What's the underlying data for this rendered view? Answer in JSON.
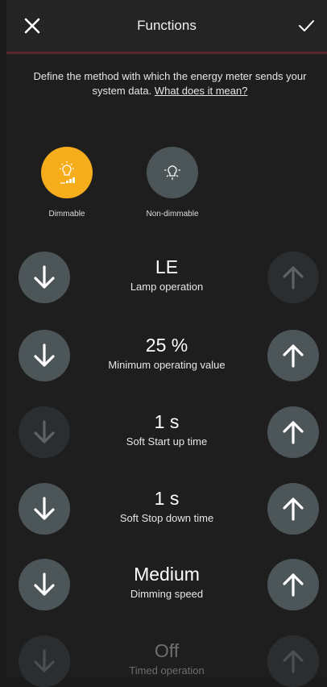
{
  "header": {
    "title": "Functions"
  },
  "description": {
    "text": "Define the method with which the energy meter sends your system data.",
    "link": "What does it mean?"
  },
  "load_type": {
    "options": [
      {
        "label": "Dimmable",
        "selected": true,
        "color": "#f5ad1b"
      },
      {
        "label": "Non-dimmable",
        "selected": false,
        "color": "#4c5558"
      }
    ]
  },
  "settings": [
    {
      "value": "LE",
      "label": "Lamp operation",
      "down_enabled": true,
      "up_enabled": false
    },
    {
      "value": "25 %",
      "label": "Minimum operating value",
      "down_enabled": true,
      "up_enabled": true
    },
    {
      "value": "1 s",
      "label": "Soft Start up time",
      "down_enabled": false,
      "up_enabled": true
    },
    {
      "value": "1 s",
      "label": "Soft Stop down time",
      "down_enabled": true,
      "up_enabled": true
    },
    {
      "value": "Medium",
      "label": "Dimming speed",
      "down_enabled": true,
      "up_enabled": true
    },
    {
      "value": "Off",
      "label": "Timed operation",
      "down_enabled": false,
      "up_enabled": false
    }
  ],
  "icons": {
    "close": "close-icon",
    "confirm": "check-icon",
    "dimmable": "bulb-dimmable-icon",
    "nondimmable": "bulb-icon",
    "decrease": "arrow-down-icon",
    "increase": "arrow-up-icon"
  }
}
